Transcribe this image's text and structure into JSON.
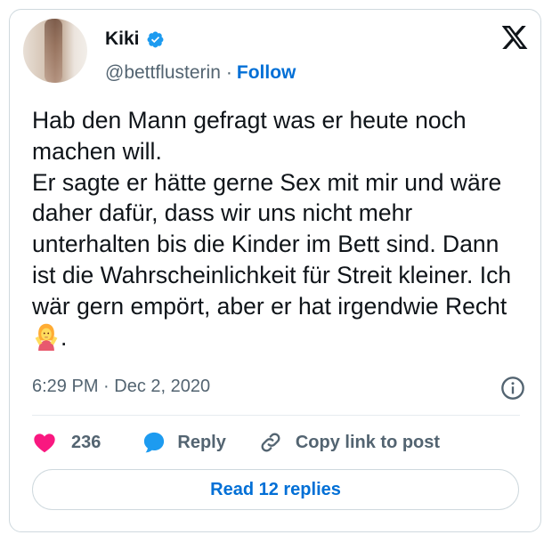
{
  "author": {
    "name": "Kiki",
    "handle": "@bettflusterin",
    "separator": "·",
    "follow_label": "Follow"
  },
  "tweet": {
    "text": "Hab den Mann gefragt was er heute noch machen will.\nEr sagte er hätte gerne Sex mit mir und wäre daher dafür, dass wir uns nicht mehr unterhalten bis die Kinder im Bett sind. Dann ist die Wahrscheinlichkeit für Streit kleiner. Ich wär gern empört, aber er hat irgendwie Recht",
    "trailing_text": ".",
    "emoji": "person-shrugging-emoji",
    "timestamp": "6:29 PM · Dec 2, 2020"
  },
  "actions": {
    "like_count": "236",
    "reply_label": "Reply",
    "copy_label": "Copy link to post"
  },
  "footer": {
    "read_replies_label": "Read 12 replies"
  },
  "colors": {
    "accent": "#006fd6",
    "like": "#f91880",
    "verified": "#1d9bf0",
    "muted_text": "#536471"
  },
  "icons": [
    "verified-badge-icon",
    "x-logo-icon",
    "info-icon",
    "heart-icon",
    "reply-bubble-icon",
    "link-icon"
  ]
}
